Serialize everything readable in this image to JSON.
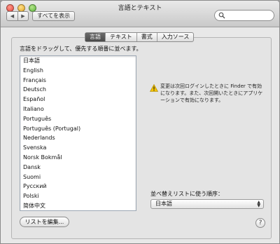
{
  "window": {
    "title": "言語とテキスト"
  },
  "toolbar": {
    "back_glyph": "◀",
    "forward_glyph": "▶",
    "show_all_label": "すべてを表示",
    "search_placeholder": "",
    "search_icon": "magnifier-icon"
  },
  "tabs": [
    {
      "label": "言語",
      "active": true
    },
    {
      "label": "テキスト",
      "active": false
    },
    {
      "label": "書式",
      "active": false
    },
    {
      "label": "入力ソース",
      "active": false
    }
  ],
  "language": {
    "instruction": "言語をドラッグして、優先する順番に並べます。",
    "items": [
      "日本語",
      "English",
      "Français",
      "Deutsch",
      "Español",
      "Italiano",
      "Português",
      "Português (Portugal)",
      "Nederlands",
      "Svenska",
      "Norsk Bokmål",
      "Dansk",
      "Suomi",
      "Русский",
      "Polski",
      "简体中文"
    ],
    "notice": "変更は次回ログインしたときに Finder で有効になります。また、次回開いたときにアプリケーションで有効になります。",
    "notice_icon": "warning-icon",
    "sort_label": "並べ替えリストに使う順序：",
    "sort_value": "日本語",
    "edit_button": "リストを編集...",
    "help_glyph": "?"
  },
  "colors": {
    "active_tab": "#555555",
    "list_border": "#9ea9b5",
    "warning": "#f5c400"
  }
}
